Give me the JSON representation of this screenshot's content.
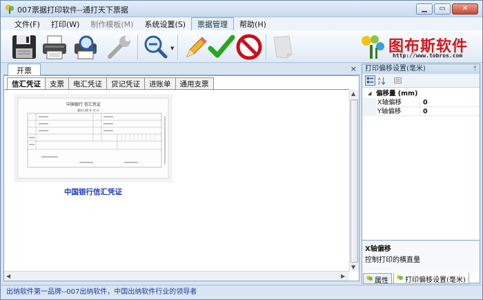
{
  "window": {
    "title": "007票据打印软件--通打天下票据",
    "controls": [
      "minimize",
      "maximize",
      "close"
    ]
  },
  "menu": {
    "items": [
      {
        "label": "文件(F)",
        "disabled": false
      },
      {
        "label": "打印(W)",
        "disabled": false
      },
      {
        "label": "制作模板(M)",
        "disabled": true
      },
      {
        "label": "系统设置(S)",
        "disabled": false
      },
      {
        "label": "票据管理",
        "disabled": false,
        "active": true
      },
      {
        "label": "帮助(H)",
        "disabled": false
      }
    ]
  },
  "toolbar": {
    "icons": [
      "save-icon",
      "printer-icon",
      "print-preview-icon",
      "wrench-icon",
      "zoom-icon",
      "pencil-icon",
      "checkmark-icon",
      "stop-icon",
      "blank-page-icon"
    ]
  },
  "logo": {
    "name": "图布斯软件",
    "url": "http://www.tobros.com"
  },
  "document": {
    "tab_label": "开票",
    "close_glyph": "×"
  },
  "voucher_tabs": [
    {
      "label": "信汇凭证",
      "active": true
    },
    {
      "label": "支票",
      "active": false
    },
    {
      "label": "电汇凭证",
      "active": false
    },
    {
      "label": "贷记凭证",
      "active": false
    },
    {
      "label": "进账单",
      "active": false
    },
    {
      "label": "通用支票",
      "active": false
    }
  ],
  "thumbnail": {
    "caption": "中国银行信汇凭证",
    "form_title": "中国银行 信汇凭证",
    "form_date": "委托日期 年 月 日"
  },
  "property_panel": {
    "title": "打印偏移设置(毫米)",
    "pin_glyph": "ᛘ",
    "category": "偏移量 (mm)",
    "properties": [
      {
        "name": "X轴偏移",
        "value": "0"
      },
      {
        "name": "Y轴偏移",
        "value": "0"
      }
    ],
    "description_title": "X轴偏移",
    "description_text": "控制打印的横直量"
  },
  "panel_tabs": [
    {
      "label": "属性",
      "active": false
    },
    {
      "label": "打印偏移设置(毫米)",
      "active": true
    }
  ],
  "status": {
    "text": "出纳软件第一品牌--007出纳软件，中国出纳软件行业的领导者"
  },
  "colors": {
    "logo_red": "#d2191b",
    "status_blue": "#1b3aa3",
    "caption_blue": "#1d3bbd",
    "check_green": "#2aa520",
    "stop_red": "#c8101b"
  }
}
